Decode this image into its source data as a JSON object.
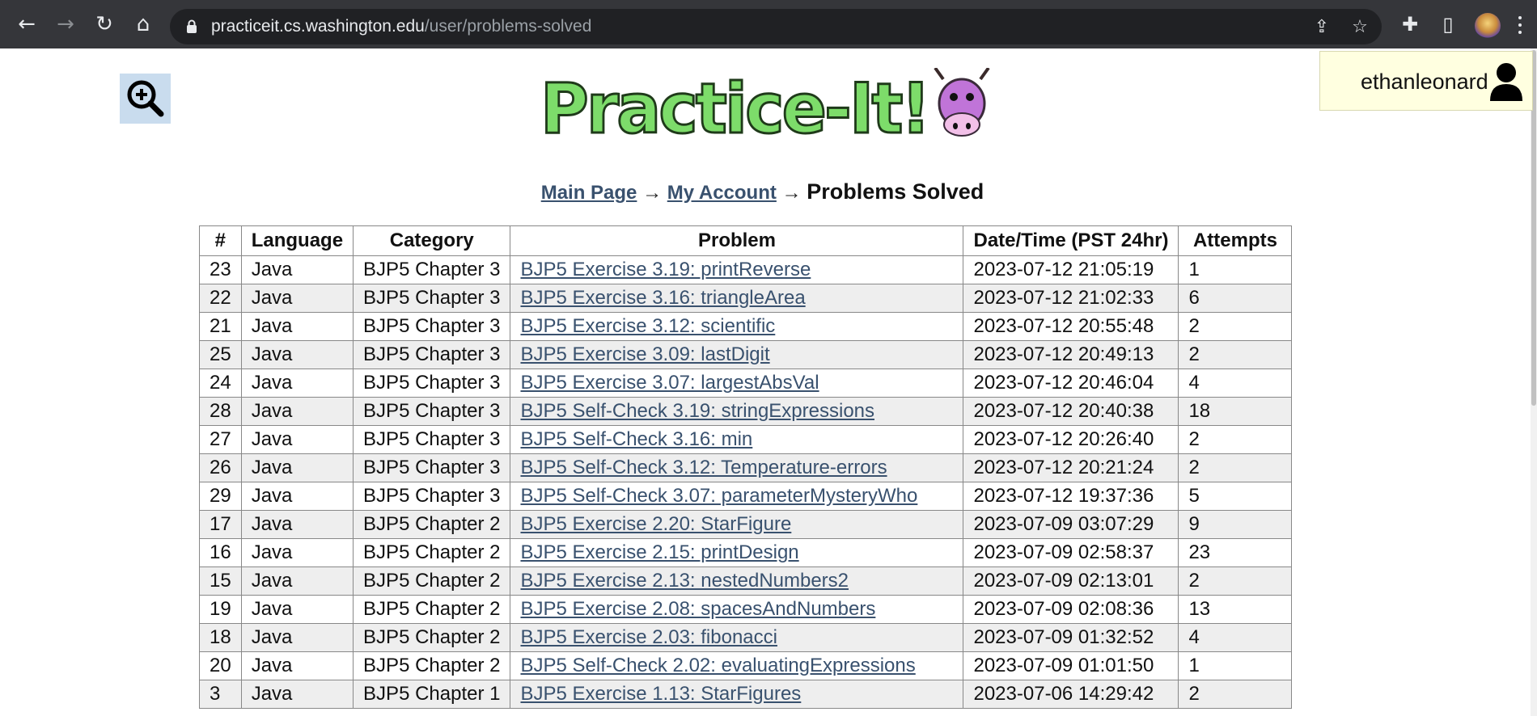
{
  "browser": {
    "url_domain": "practiceit.cs.washington.edu",
    "url_path": "/user/problems-solved",
    "back_icon": "←",
    "forward_icon": "→",
    "reload_icon": "↻",
    "home_icon": "⌂",
    "share_icon": "⇪",
    "star_icon": "☆",
    "extensions_icon": "✚",
    "sidepanel_icon": "▯"
  },
  "header": {
    "username": "ethanleonard",
    "logo_text": "Practice-It!"
  },
  "breadcrumb": {
    "main_page": "Main Page",
    "arrow1": "→",
    "my_account": "My Account",
    "arrow2": "→",
    "current": "Problems Solved"
  },
  "table": {
    "headers": [
      "#",
      "Language",
      "Category",
      "Problem",
      "Date/Time (PST 24hr)",
      "Attempts"
    ],
    "rows": [
      {
        "num": "23",
        "lang": "Java",
        "cat": "BJP5 Chapter 3",
        "problem": "BJP5 Exercise 3.19: printReverse",
        "date": "2023-07-12 21:05:19",
        "attempts": "1"
      },
      {
        "num": "22",
        "lang": "Java",
        "cat": "BJP5 Chapter 3",
        "problem": "BJP5 Exercise 3.16: triangleArea",
        "date": "2023-07-12 21:02:33",
        "attempts": "6"
      },
      {
        "num": "21",
        "lang": "Java",
        "cat": "BJP5 Chapter 3",
        "problem": "BJP5 Exercise 3.12: scientific",
        "date": "2023-07-12 20:55:48",
        "attempts": "2"
      },
      {
        "num": "25",
        "lang": "Java",
        "cat": "BJP5 Chapter 3",
        "problem": "BJP5 Exercise 3.09: lastDigit",
        "date": "2023-07-12 20:49:13",
        "attempts": "2"
      },
      {
        "num": "24",
        "lang": "Java",
        "cat": "BJP5 Chapter 3",
        "problem": "BJP5 Exercise 3.07: largestAbsVal",
        "date": "2023-07-12 20:46:04",
        "attempts": "4"
      },
      {
        "num": "28",
        "lang": "Java",
        "cat": "BJP5 Chapter 3",
        "problem": "BJP5 Self-Check 3.19: stringExpressions",
        "date": "2023-07-12 20:40:38",
        "attempts": "18"
      },
      {
        "num": "27",
        "lang": "Java",
        "cat": "BJP5 Chapter 3",
        "problem": "BJP5 Self-Check 3.16: min",
        "date": "2023-07-12 20:26:40",
        "attempts": "2"
      },
      {
        "num": "26",
        "lang": "Java",
        "cat": "BJP5 Chapter 3",
        "problem": "BJP5 Self-Check 3.12: Temperature-errors",
        "date": "2023-07-12 20:21:24",
        "attempts": "2"
      },
      {
        "num": "29",
        "lang": "Java",
        "cat": "BJP5 Chapter 3",
        "problem": "BJP5 Self-Check 3.07: parameterMysteryWho",
        "date": "2023-07-12 19:37:36",
        "attempts": "5"
      },
      {
        "num": "17",
        "lang": "Java",
        "cat": "BJP5 Chapter 2",
        "problem": "BJP5 Exercise 2.20: StarFigure",
        "date": "2023-07-09 03:07:29",
        "attempts": "9"
      },
      {
        "num": "16",
        "lang": "Java",
        "cat": "BJP5 Chapter 2",
        "problem": "BJP5 Exercise 2.15: printDesign",
        "date": "2023-07-09 02:58:37",
        "attempts": "23"
      },
      {
        "num": "15",
        "lang": "Java",
        "cat": "BJP5 Chapter 2",
        "problem": "BJP5 Exercise 2.13: nestedNumbers2",
        "date": "2023-07-09 02:13:01",
        "attempts": "2"
      },
      {
        "num": "19",
        "lang": "Java",
        "cat": "BJP5 Chapter 2",
        "problem": "BJP5 Exercise 2.08: spacesAndNumbers",
        "date": "2023-07-09 02:08:36",
        "attempts": "13"
      },
      {
        "num": "18",
        "lang": "Java",
        "cat": "BJP5 Chapter 2",
        "problem": "BJP5 Exercise 2.03: fibonacci",
        "date": "2023-07-09 01:32:52",
        "attempts": "4"
      },
      {
        "num": "20",
        "lang": "Java",
        "cat": "BJP5 Chapter 2",
        "problem": "BJP5 Self-Check 2.02: evaluatingExpressions",
        "date": "2023-07-09 01:01:50",
        "attempts": "1"
      },
      {
        "num": "3",
        "lang": "Java",
        "cat": "BJP5 Chapter 1",
        "problem": "BJP5 Exercise 1.13: StarFigures",
        "date": "2023-07-06 14:29:42",
        "attempts": "2"
      }
    ]
  },
  "colors": {
    "chrome_bg": "#35363a",
    "omnibox_bg": "#202124",
    "link": "#39516e",
    "zebra": "#eeeeee",
    "user_box": "#ffffe0",
    "logo_green": "#7ddc6a",
    "cow_purple": "#c074d8"
  }
}
